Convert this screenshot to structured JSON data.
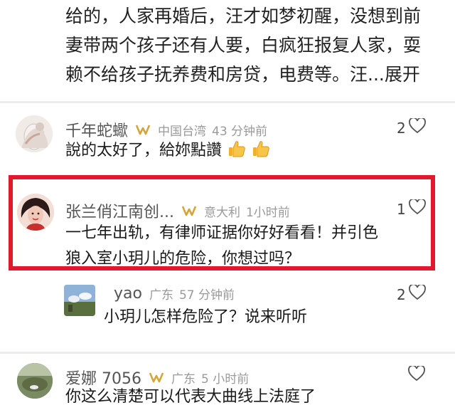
{
  "top_text": {
    "line1": "给的，人家再婚后，汪才如梦初醒，没想到前",
    "line2": "妻带两个孩子还有人要，白疯狂报复人家，耍",
    "line3": "赖不给孩子抚养费和房贷，电费等。汪...",
    "expand": "展开"
  },
  "comments": [
    {
      "username": "千年蛇蠍",
      "location": "中国台湾",
      "time": "43 分钟前",
      "likes": "2",
      "text": "說的太好了，給妳點讚"
    },
    {
      "username": "张兰俏江南创...",
      "location": "意大利",
      "time": "1小时前",
      "likes": "1",
      "text_line1": "一七年出轨，有律师证据你好好看看！并引色",
      "text_line2": "狼入室小玥儿的危险，你想过吗？"
    },
    {
      "username": "yao",
      "location": "广东",
      "time": "57 分钟前",
      "likes": "2",
      "text": "小玥儿怎样危险了？说来听听"
    },
    {
      "username": "爱娜 7056",
      "location": "广东",
      "time": "5 小时前",
      "likes": "",
      "text": "你这么清楚可以代表大曲线上法庭了"
    }
  ],
  "colors": {
    "highlight": "#e0192c",
    "badge": "#d4a63a",
    "meta_gray": "#9a9a9a"
  }
}
